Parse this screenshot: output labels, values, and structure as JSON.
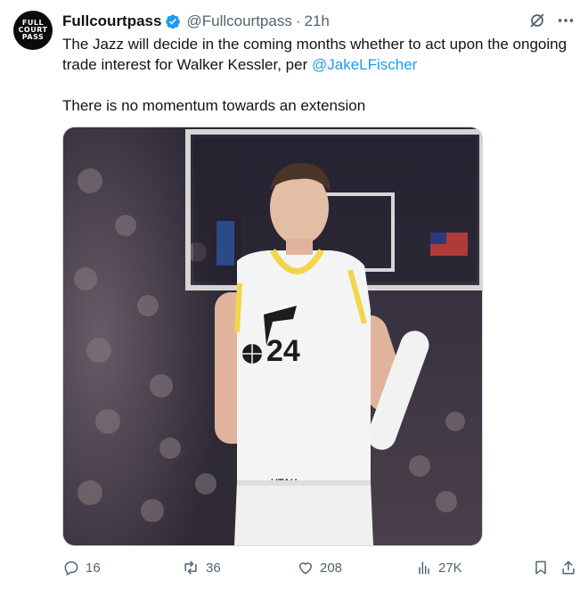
{
  "tweet": {
    "avatar_text": [
      "FULL",
      "COURT",
      "PASS"
    ],
    "author_name": "Fullcourtpass",
    "handle": "@Fullcourtpass",
    "separator": "·",
    "time": "21h",
    "text_line1_prefix": "The Jazz will decide in the coming months whether to act upon the ongoing trade interest for Walker Kessler, per ",
    "mention": "@JakeLFischer",
    "text_line2": "There is no momentum towards an extension",
    "jersey_number": "24",
    "jersey_city": "UTAH"
  },
  "actions": {
    "replies": "16",
    "retweets": "36",
    "likes": "208",
    "views": "27K"
  },
  "colors": {
    "accent": "#1d9bf0",
    "muted": "#536471",
    "jersey_trim": "#f2d54b"
  },
  "icons": [
    "verified-badge-icon",
    "grok-icon",
    "more-icon",
    "reply-icon",
    "retweet-icon",
    "like-icon",
    "views-icon",
    "bookmark-icon",
    "share-icon"
  ]
}
